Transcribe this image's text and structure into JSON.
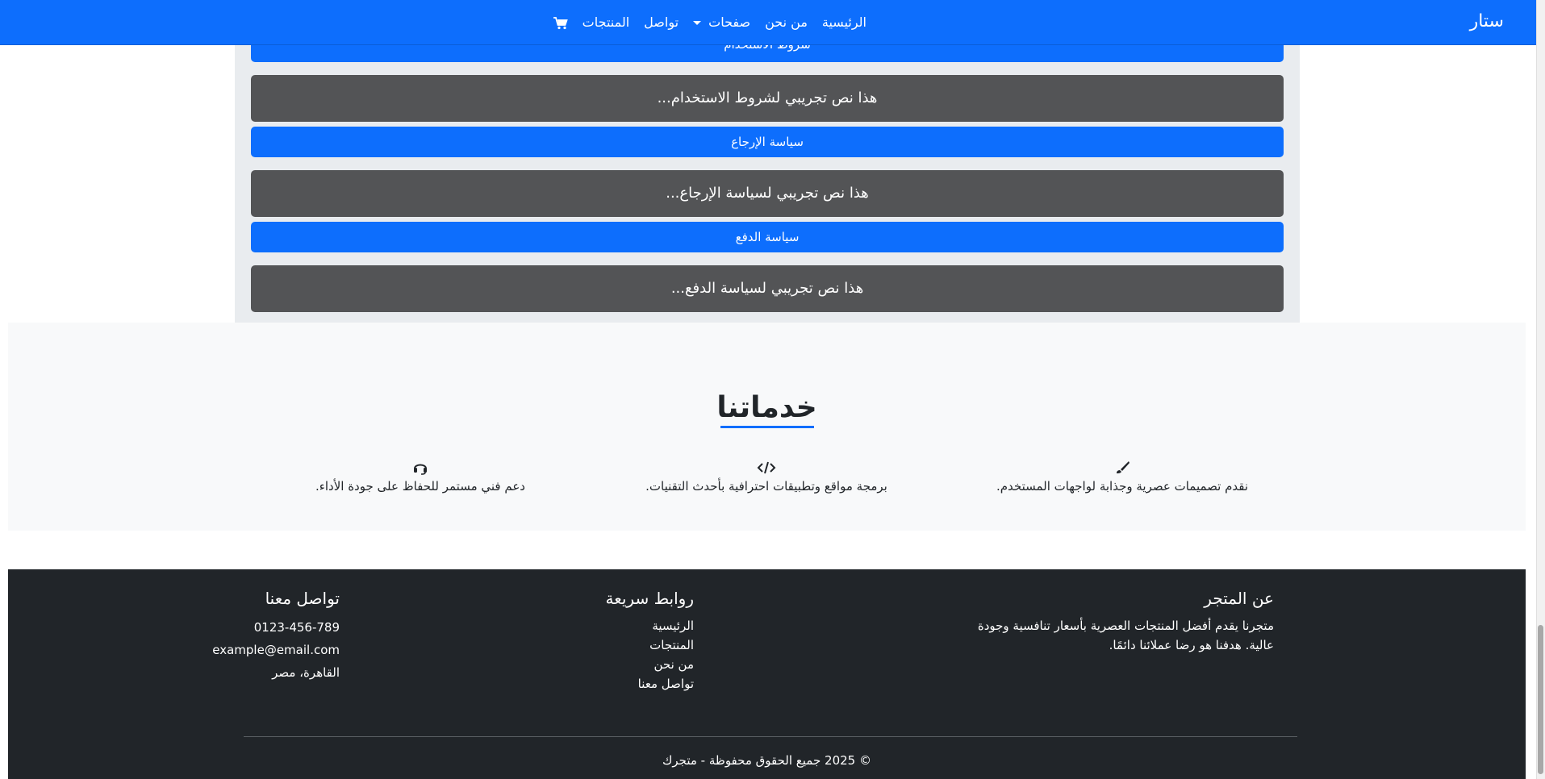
{
  "navbar": {
    "brand": "ستار",
    "links": {
      "home": "الرئيسية",
      "about": "من نحن",
      "pages": "صفحات",
      "contact": "تواصل",
      "products": "المنتجات"
    },
    "icons": {
      "dropdown": "caret-down-icon",
      "cart": "cart-icon"
    }
  },
  "accordion": {
    "items": [
      {
        "header": "شروط الاستخدام",
        "body": "هذا نص تجريبي لشروط الاستخدام..."
      },
      {
        "header": "سياسة الإرجاع",
        "body": "هذا نص تجريبي لسياسة الإرجاع..."
      },
      {
        "header": "سياسة الدفع",
        "body": "هذا نص تجريبي لسياسة الدفع..."
      }
    ]
  },
  "services": {
    "title": "خدماتنا",
    "items": [
      {
        "icon": "brush-icon",
        "text": "نقدم تصميمات عصرية وجذابة لواجهات المستخدم."
      },
      {
        "icon": "code-icon",
        "text": "برمجة مواقع وتطبيقات احترافية بأحدث التقنيات."
      },
      {
        "icon": "headset-icon",
        "text": "دعم فني مستمر للحفاظ على جودة الأداء."
      }
    ]
  },
  "footer": {
    "about": {
      "title": "عن المتجر",
      "text": "متجرنا يقدم أفضل المنتجات العصرية بأسعار تنافسية وجودة عالية. هدفنا هو رضا عملائنا دائمًا."
    },
    "quick_links": {
      "title": "روابط سريعة",
      "links": [
        "الرئيسية",
        "المنتجات",
        "من نحن",
        "تواصل معنا"
      ]
    },
    "contact": {
      "title": "تواصل معنا",
      "phone": "0123-456-789",
      "email": "example@email.com",
      "address": "القاهرة، مصر"
    },
    "copyright": "© 2025 جميع الحقوق محفوظة - متجرك"
  },
  "colors": {
    "primary": "#0d6efd",
    "accordion_body": "#535456",
    "footer_bg": "#212529",
    "section_bg": "#f8f9fa"
  }
}
